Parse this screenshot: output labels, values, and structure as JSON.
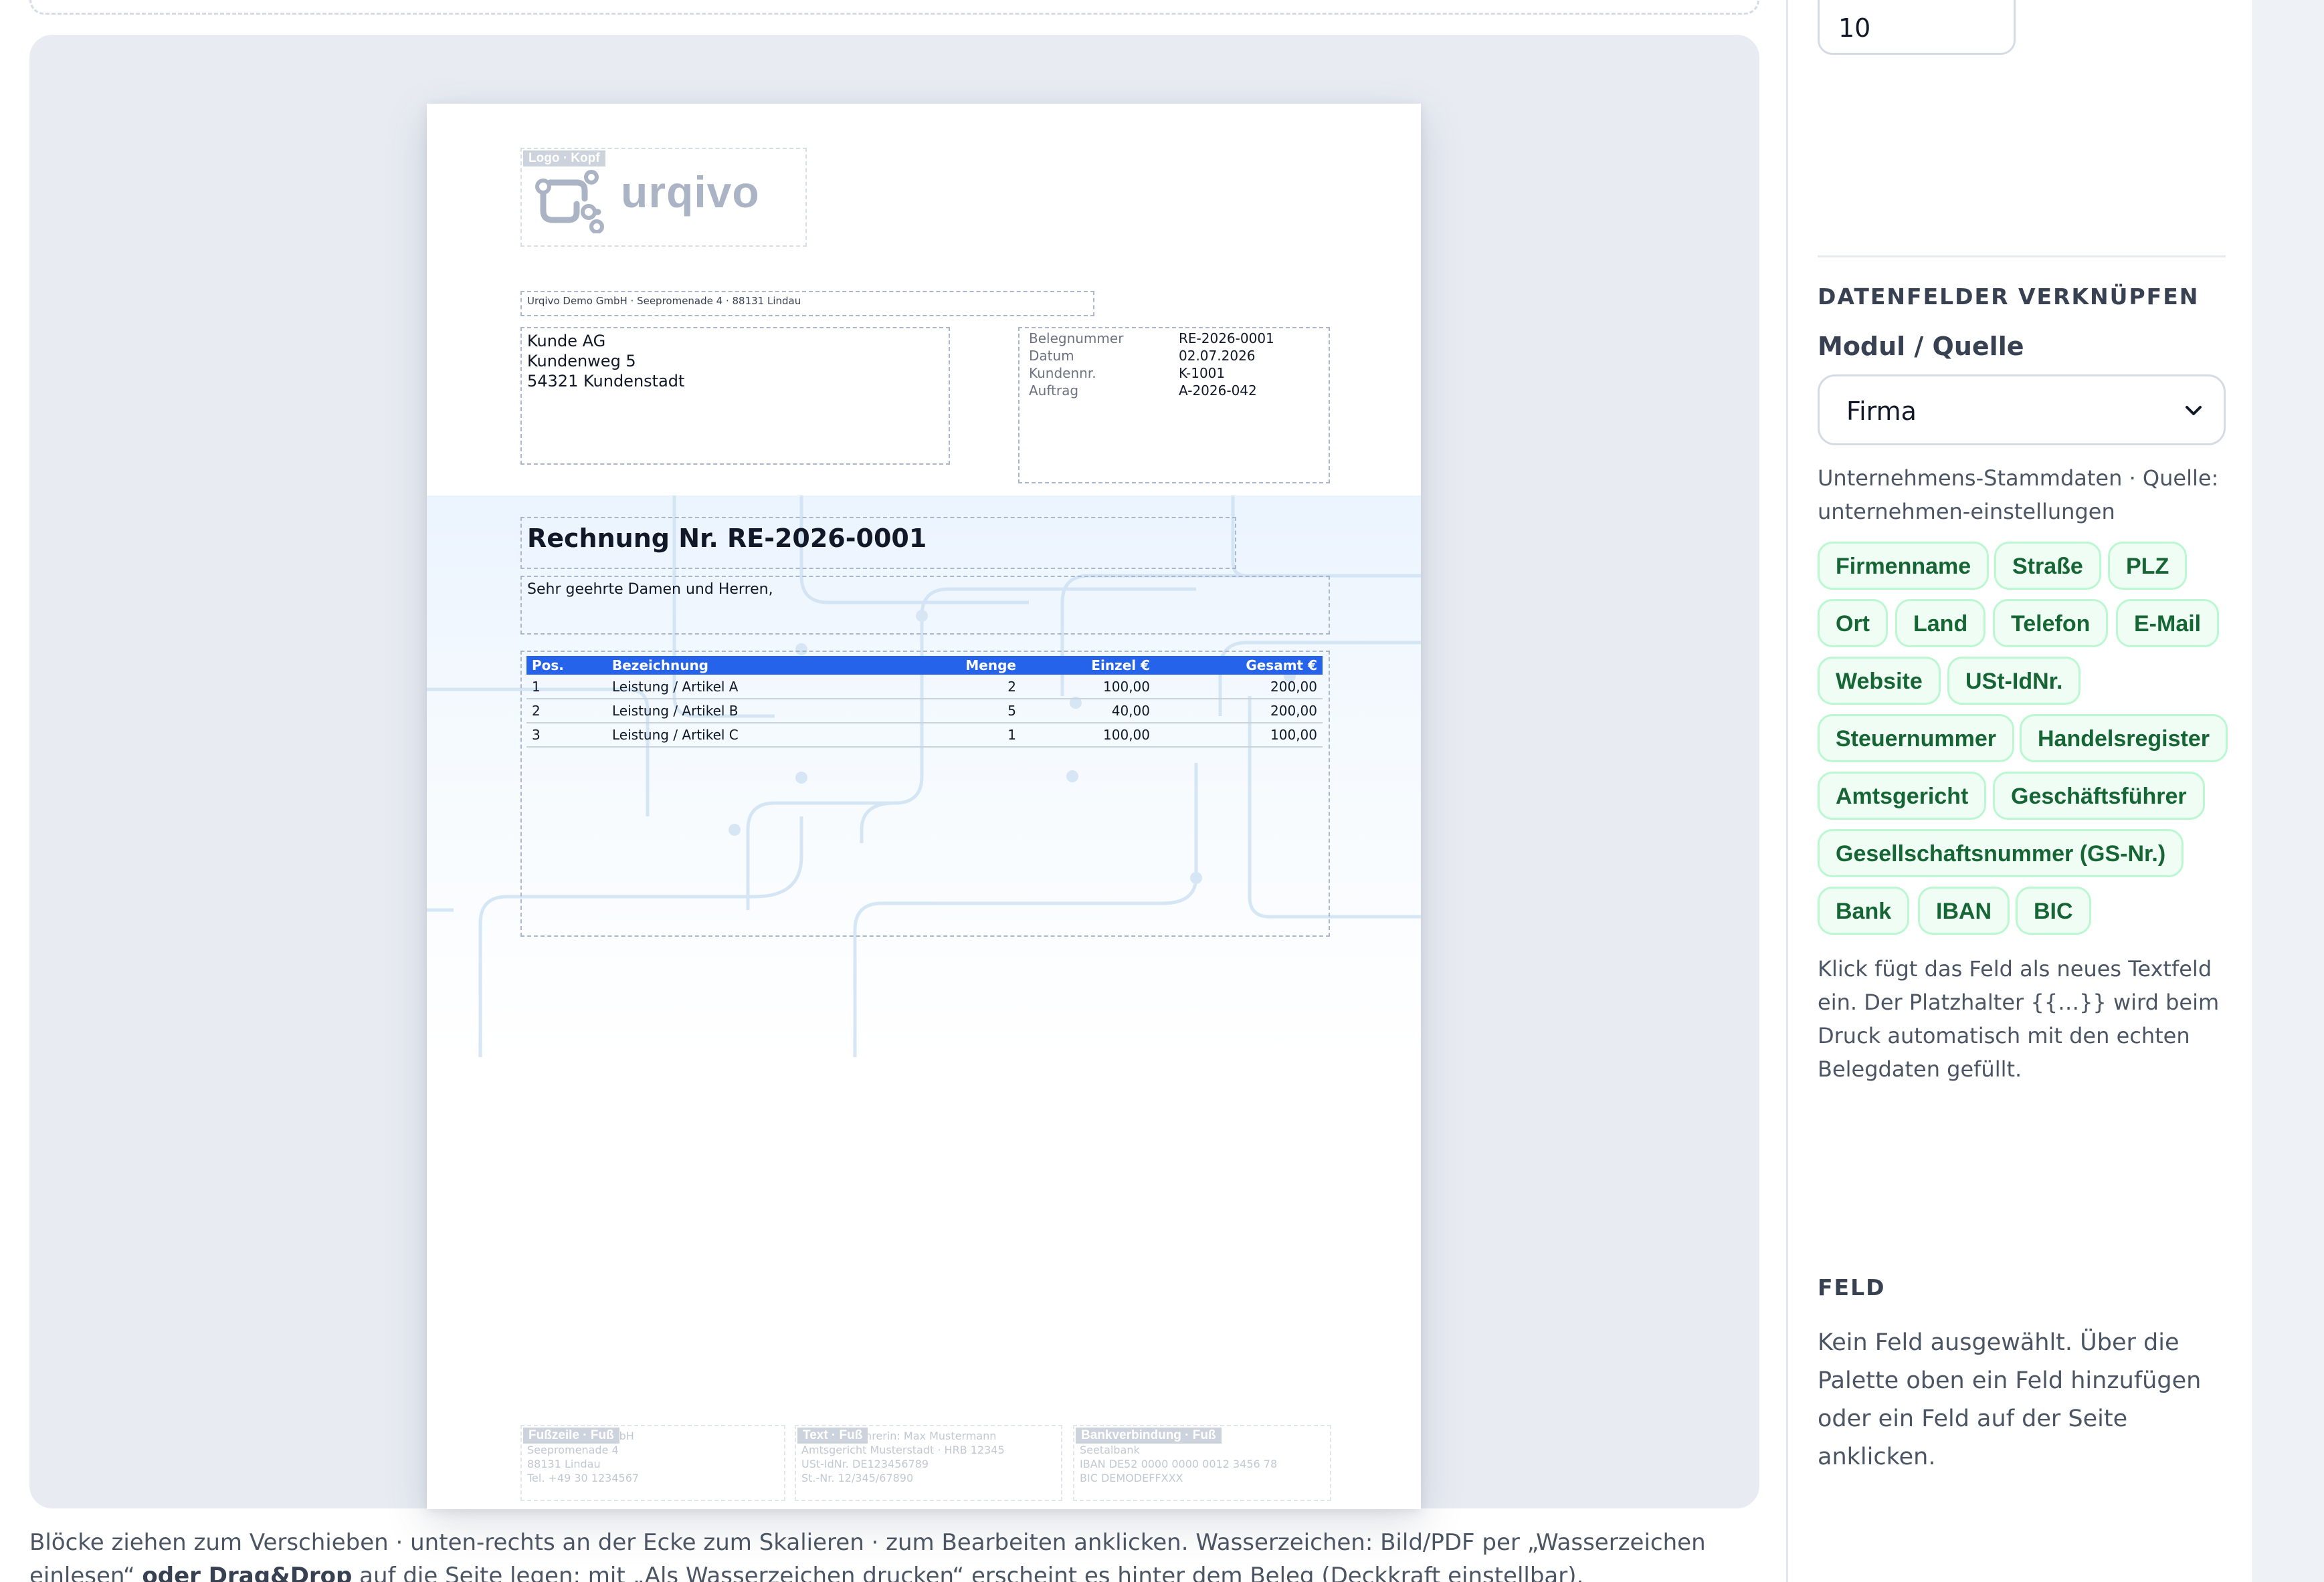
{
  "document": {
    "logo_tag": "Logo · Kopf",
    "logo_text": "urqivo",
    "sender_line": "Urqivo Demo GmbH · Seepromenade 4 · 88131 Lindau",
    "recipient": [
      "Kunde AG",
      "Kundenweg 5",
      "54321 Kundenstadt"
    ],
    "meta": [
      {
        "label": "Belegnummer",
        "value": "RE-2026-0001"
      },
      {
        "label": "Datum",
        "value": "02.07.2026"
      },
      {
        "label": "Kundennr.",
        "value": "K-1001"
      },
      {
        "label": "Auftrag",
        "value": "A-2026-042"
      }
    ],
    "title": "Rechnung Nr. RE-2026-0001",
    "greeting": "Sehr geehrte Damen und Herren,",
    "table": {
      "headers": [
        "Pos.",
        "Bezeichnung",
        "Menge",
        "Einzel €",
        "Gesamt €"
      ],
      "rows": [
        [
          "1",
          "Leistung / Artikel A",
          "2",
          "100,00",
          "200,00"
        ],
        [
          "2",
          "Leistung / Artikel B",
          "5",
          "40,00",
          "200,00"
        ],
        [
          "3",
          "Leistung / Artikel C",
          "1",
          "100,00",
          "100,00"
        ]
      ]
    },
    "footer": [
      {
        "tag": "Fußzeile · Fuß",
        "lines": [
          "Urqivo Demo GmbH",
          "Seepromenade 4",
          "88131 Lindau",
          "Tel. +49 30 1234567"
        ]
      },
      {
        "tag": "Text · Fuß",
        "lines": [
          "Geschäftsführerin: Max Mustermann",
          "Amtsgericht Musterstadt · HRB 12345",
          "USt-IdNr. DE123456789",
          "St.-Nr. 12/345/67890"
        ]
      },
      {
        "tag": "Bankverbindung · Fuß",
        "lines": [
          "",
          "Seetalbank",
          "IBAN DE52 0000 0000 0012 3456 78",
          "BIC DEMODEFFXXX"
        ]
      }
    ]
  },
  "help": {
    "text_start": "Blöcke ziehen zum Verschieben · unten-rechts an der Ecke zum Skalieren · zum Bearbeiten anklicken. Wasserzeichen: Bild/PDF per „Wasserzeichen einlesen“ ",
    "text_bold": "oder Drag&Drop",
    "text_end": " auf die Seite legen; mit „Als Wasserzeichen drucken“ erscheint es hinter dem Beleg (Deckkraft einstellbar)."
  },
  "panel": {
    "number_value": "10",
    "link_heading": "DATENFELDER VERKNÜPFEN",
    "modul_label": "Modul / Quelle",
    "modul_selected": "Firma",
    "source_desc": "Unternehmens-Stammdaten · Quelle: unternehmen-einstellungen",
    "chips": [
      "Firmenname",
      "Straße",
      "PLZ",
      "Ort",
      "Land",
      "Telefon",
      "E-Mail",
      "Website",
      "USt-IdNr.",
      "Steuernummer",
      "Handelsregister",
      "Amtsgericht",
      "Geschäftsführer",
      "Gesellschaftsnummer (GS-Nr.)",
      "Bank",
      "IBAN",
      "BIC"
    ],
    "hint": "Klick fügt das Feld als neues Textfeld ein. Der Platzhalter {{…}} wird beim Druck automatisch mit den echten Belegdaten gefüllt.",
    "feld_heading": "FELD",
    "feld_text": "Kein Feld ausgewählt. Über die Palette oben ein Feld hinzufügen oder ein Feld auf der Seite anklicken."
  },
  "colors": {
    "accent": "#2563eb",
    "chip_text": "#166534",
    "chip_bg": "#f0fdf4",
    "chip_border": "#bbf7d0"
  },
  "icons": [
    "logo-mark-icon",
    "chevron-down-icon"
  ]
}
